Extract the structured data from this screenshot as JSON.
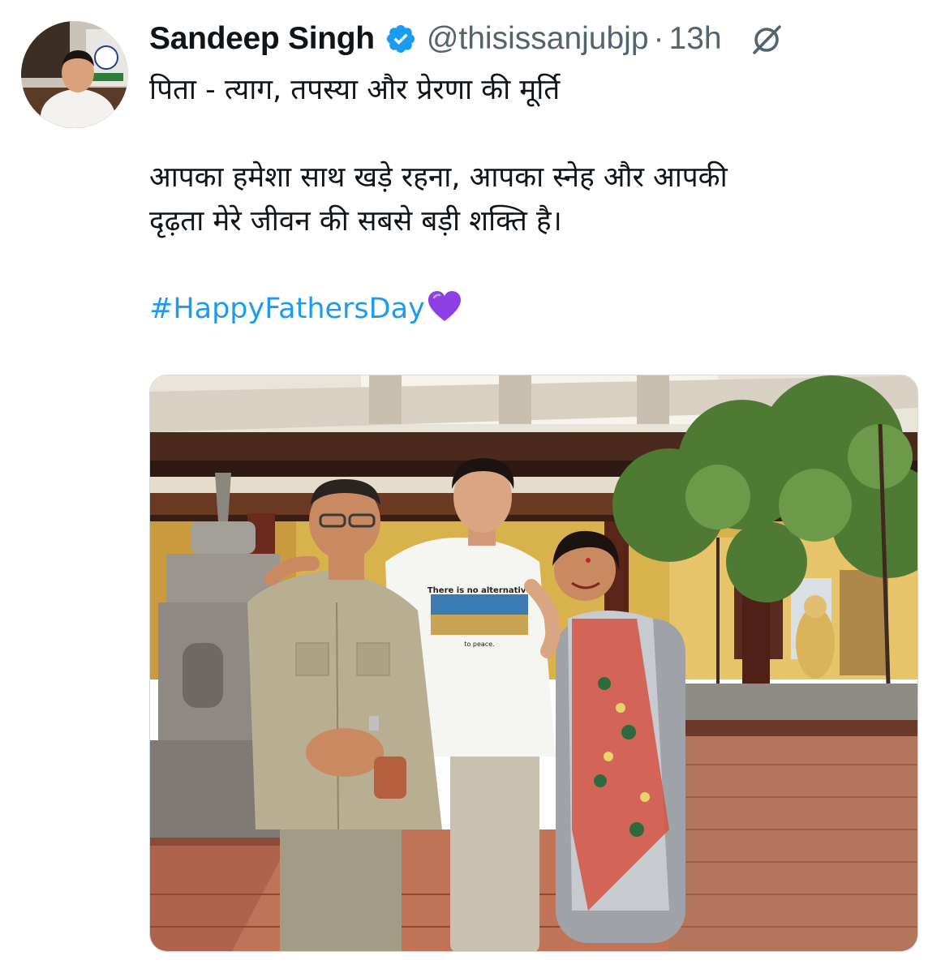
{
  "tweet": {
    "author_name": "Sandeep Singh",
    "handle": "@thisissanjubjp",
    "separator": "·",
    "time_ago": "13h",
    "text_line1": "पिता - त्याग, तपस्या और प्रेरणा की मूर्ति",
    "text_line2": "आपका हमेशा साथ खड़े रहना, आपका स्नेह और आपकी",
    "text_line3": "दृढ़ता मेरे जीवन की सबसे बड़ी शक्ति है।",
    "hashtag": "#HappyFathersDay"
  },
  "photo": {
    "tshirt_line1": "There is no alternative",
    "tshirt_line2": "to peace."
  },
  "icons": {
    "verified": "verified-badge-icon",
    "grok": "grok-icon",
    "heart": "purple-heart-emoji"
  },
  "colors": {
    "text": "#0f1419",
    "secondary": "#536471",
    "link": "#1d9bf0",
    "verified": "#1d9bf0",
    "heart": "#8f3fe6"
  }
}
